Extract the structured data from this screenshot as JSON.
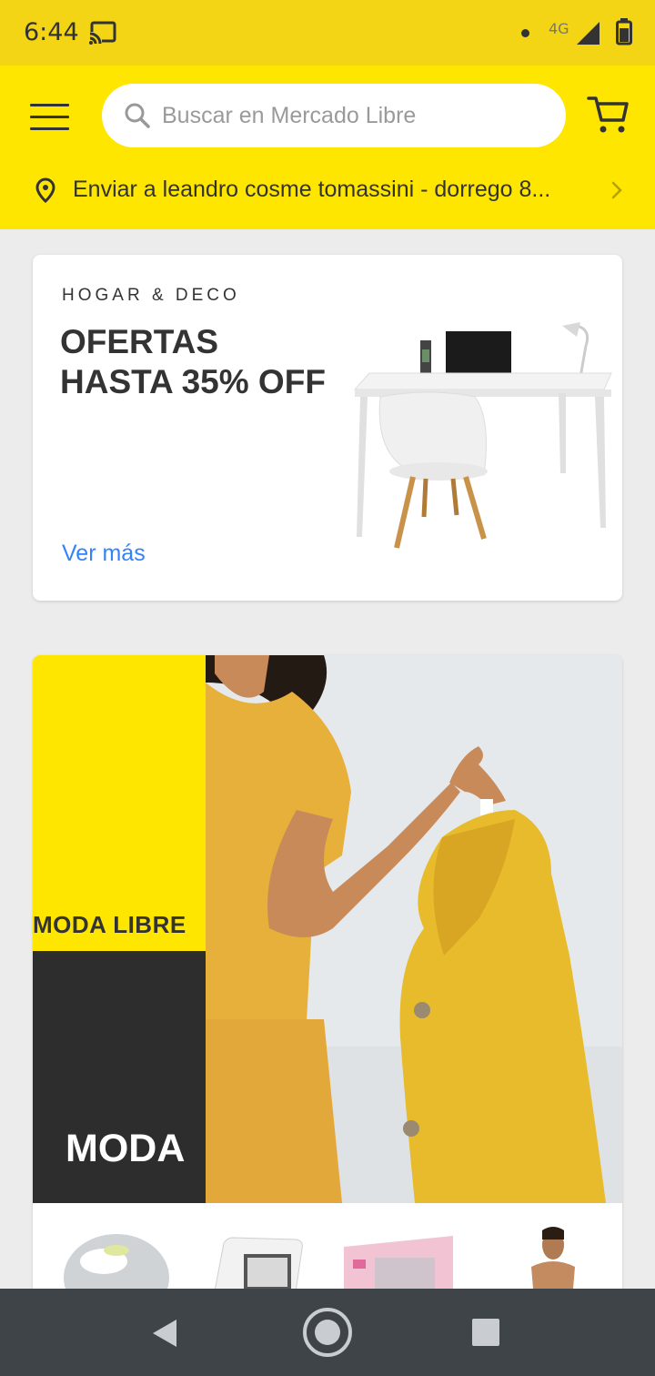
{
  "status_bar": {
    "time": "6:44",
    "network": "4G",
    "icons": [
      "cast-icon",
      "signal-icon",
      "battery-icon"
    ]
  },
  "header": {
    "search_placeholder": "Buscar en Mercado Libre",
    "shipping_text": "Enviar a leandro cosme tomassini - dorrego 8...",
    "icons": [
      "menu-icon",
      "search-icon",
      "cart-icon",
      "location-pin-icon",
      "chevron-right-icon"
    ]
  },
  "promo_card": {
    "kicker": "HOGAR & DECO",
    "headline_line1": "OFERTAS",
    "headline_line2": "HASTA 35% OFF",
    "link": "Ver más"
  },
  "fashion_card": {
    "banner_label": "MODA LIBRE",
    "title": "MODA"
  },
  "nav_bar": {
    "icons": [
      "back-icon",
      "home-icon",
      "recents-icon"
    ]
  },
  "colors": {
    "brand_yellow": "#ffe600",
    "status_yellow": "#f3d516",
    "link_blue": "#3483fa",
    "text_dark": "#333333",
    "nav_dark": "#3f4449"
  }
}
